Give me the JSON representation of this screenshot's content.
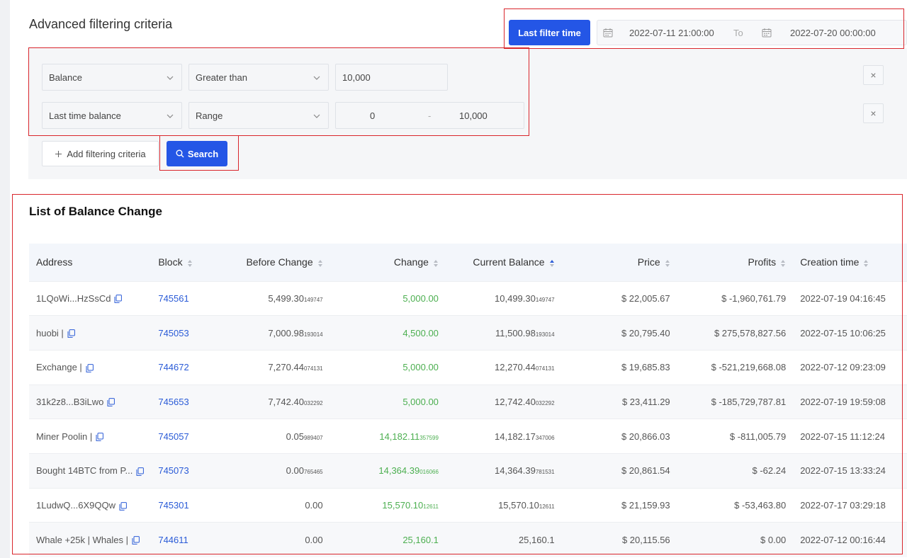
{
  "filter": {
    "title": "Advanced filtering criteria",
    "last_filter_btn": "Last filter time",
    "date_from": "2022-07-11 21:00:00",
    "date_to_label": "To",
    "date_to": "2022-07-20 00:00:00",
    "rows": [
      {
        "field": "Balance",
        "op": "Greater than",
        "value": "10,000"
      },
      {
        "field": "Last time balance",
        "op": "Range",
        "min": "0",
        "dash": "-",
        "max": "10,000"
      }
    ],
    "remove_icon": "×",
    "add_label": "Add filtering criteria",
    "search_label": "Search"
  },
  "table": {
    "title": "List of Balance Change",
    "columns": [
      "Address",
      "Block",
      "Before Change",
      "Change",
      "Current Balance",
      "Price",
      "Profits",
      "Creation time"
    ],
    "rows": [
      {
        "address": "1LQoWi...HzSsCd",
        "block": "745561",
        "before": "5,499.30",
        "before_sm": "149747",
        "change": "5,000.00",
        "change_sm": "",
        "current": "10,499.30",
        "current_sm": "149747",
        "price": "$ 22,005.67",
        "profits": "$ -1,960,761.79",
        "time": "2022-07-19 04:16:45"
      },
      {
        "address": "huobi |",
        "block": "745053",
        "before": "7,000.98",
        "before_sm": "193014",
        "change": "4,500.00",
        "change_sm": "",
        "current": "11,500.98",
        "current_sm": "193014",
        "price": "$ 20,795.40",
        "profits": "$ 275,578,827.56",
        "time": "2022-07-15 10:06:25"
      },
      {
        "address": "Exchange |",
        "block": "744672",
        "before": "7,270.44",
        "before_sm": "074131",
        "change": "5,000.00",
        "change_sm": "",
        "current": "12,270.44",
        "current_sm": "074131",
        "price": "$ 19,685.83",
        "profits": "$ -521,219,668.08",
        "time": "2022-07-12 09:23:09"
      },
      {
        "address": "31k2z8...B3iLwo",
        "block": "745653",
        "before": "7,742.40",
        "before_sm": "032292",
        "change": "5,000.00",
        "change_sm": "",
        "current": "12,742.40",
        "current_sm": "032292",
        "price": "$ 23,411.29",
        "profits": "$ -185,729,787.81",
        "time": "2022-07-19 19:59:08"
      },
      {
        "address": "Miner Poolin |",
        "block": "745057",
        "before": "0.05",
        "before_sm": "989407",
        "change": "14,182.11",
        "change_sm": "357599",
        "current": "14,182.17",
        "current_sm": "347006",
        "price": "$ 20,866.03",
        "profits": "$ -811,005.79",
        "time": "2022-07-15 11:12:24"
      },
      {
        "address": "Bought 14BTC from P...",
        "block": "745073",
        "before": "0.00",
        "before_sm": "765465",
        "change": "14,364.39",
        "change_sm": "016066",
        "current": "14,364.39",
        "current_sm": "781531",
        "price": "$ 20,861.54",
        "profits": "$ -62.24",
        "time": "2022-07-15 13:33:24"
      },
      {
        "address": "1LudwQ...6X9QQw",
        "block": "745301",
        "before": "0.00",
        "before_sm": "",
        "change": "15,570.10",
        "change_sm": "12611",
        "current": "15,570.10",
        "current_sm": "12611",
        "price": "$ 21,159.93",
        "profits": "$ -53,463.80",
        "time": "2022-07-17 03:29:18"
      },
      {
        "address": "Whale +25k | Whales |",
        "block": "744611",
        "before": "0.00",
        "before_sm": "",
        "change": "25,160.1",
        "change_sm": "",
        "current": "25,160.1",
        "current_sm": "",
        "price": "$ 20,115.56",
        "profits": "$ 0.00",
        "time": "2022-07-12 00:16:44"
      }
    ]
  },
  "icons": {
    "calendar": "calendar-icon",
    "chevron": "chevron-down-icon",
    "copy": "copy-icon",
    "sort": "sort-icon",
    "search": "search-icon",
    "plus": "plus-icon"
  },
  "colors": {
    "primary": "#2456e6",
    "highlight_border": "#d9262c",
    "block_link": "#2a5bd7",
    "positive": "#4caf50"
  }
}
